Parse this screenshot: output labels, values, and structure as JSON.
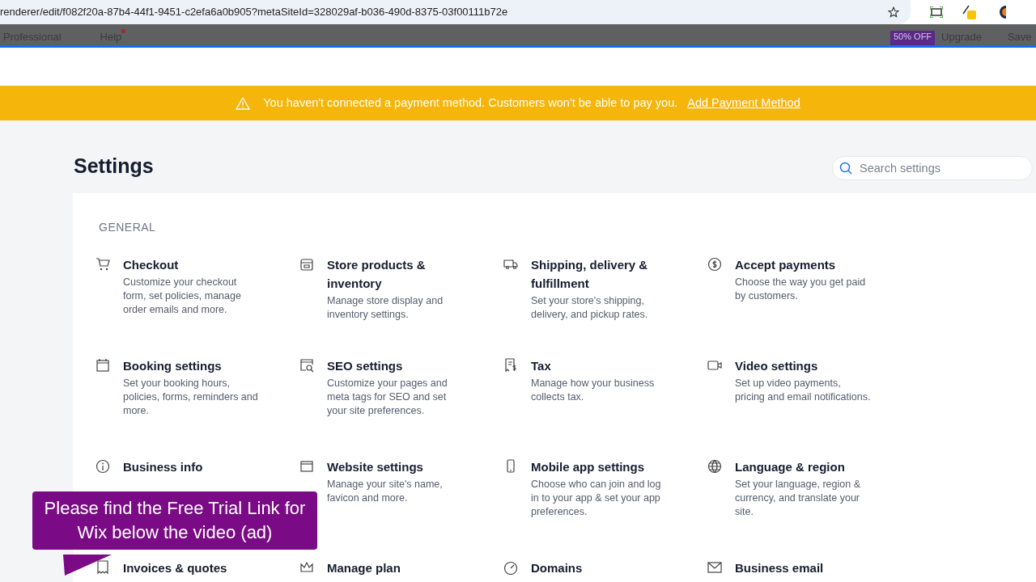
{
  "browser": {
    "address": "renderer/edit/f082f20a-87b4-44f1-9451-c2efa6a0b905?metaSiteId=328029af-b036-490d-8375-03f00111b72e"
  },
  "editor_bar": {
    "left": [
      "Professional",
      "Help"
    ],
    "badge": "50% OFF",
    "upgrade": "Upgrade",
    "save": "Save"
  },
  "banner": {
    "message": "You haven't connected a payment method. Customers won't be able to pay you.",
    "link": "Add Payment Method"
  },
  "page": {
    "title": "Settings",
    "search": {
      "placeholder": "Search settings"
    }
  },
  "section": {
    "heading": "GENERAL",
    "items": [
      {
        "title": "Checkout",
        "description": "Customize your checkout form, set policies, manage order emails and more."
      },
      {
        "title": "Store products & inventory",
        "description": "Manage store display and inventory settings."
      },
      {
        "title": "Shipping, delivery & fulfillment",
        "description": "Set your store's shipping, delivery, and pickup rates."
      },
      {
        "title": "Accept payments",
        "description": "Choose the way you get paid by customers."
      },
      {
        "title": "Booking settings",
        "description": "Set your booking hours, policies, forms, reminders and more."
      },
      {
        "title": "SEO settings",
        "description": "Customize your pages and meta tags for SEO and set your site preferences."
      },
      {
        "title": "Tax",
        "description": "Manage how your business collects tax."
      },
      {
        "title": "Video settings",
        "description": "Set up video payments, pricing and email notifications."
      },
      {
        "title": "Business info"
      },
      {
        "title": "Website settings",
        "description": "Manage your site's name, favicon and more."
      },
      {
        "title": "Mobile app settings",
        "description": "Choose who can join and log in to your app & set your app preferences."
      },
      {
        "title": "Language & region",
        "description": "Set your language, region & currency, and translate your site."
      },
      {
        "title": "Invoices & quotes"
      },
      {
        "title": "Manage plan"
      },
      {
        "title": "Domains"
      },
      {
        "title": "Business email"
      }
    ]
  },
  "overlay": {
    "text": "Please find the Free Trial Link for Wix below the video (ad)"
  }
}
